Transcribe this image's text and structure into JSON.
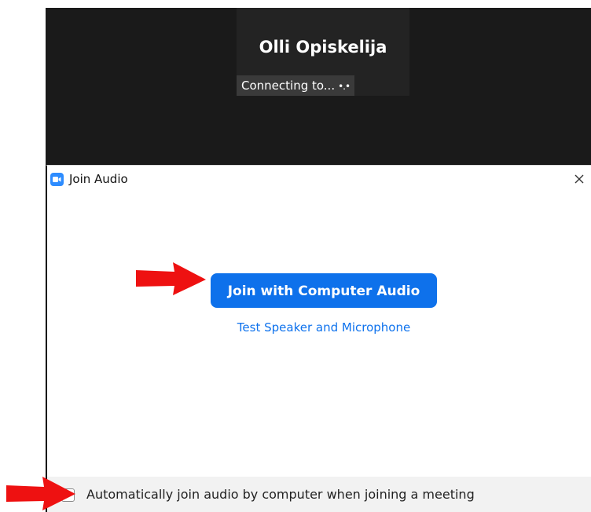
{
  "video": {
    "participant_name": "Olli Opiskelija",
    "status_text": "Connecting to...",
    "status_dots": "•.•"
  },
  "dialog": {
    "title": "Join Audio",
    "app_icon": "zoom-camera-icon",
    "close_icon": "close-icon",
    "join_button_label": "Join with Computer Audio",
    "test_link_label": "Test Speaker and Microphone",
    "auto_join_checked": false,
    "auto_join_label": "Automatically join audio by computer when joining a meeting"
  },
  "annotations": {
    "arrow_icon": "red-arrow-icon",
    "arrow_color": "#ee1111"
  },
  "colors": {
    "video_bg": "#1a1a1a",
    "primary_blue": "#0e71eb",
    "link_blue": "#0e72ed",
    "footer_bg": "#f2f2f2"
  }
}
